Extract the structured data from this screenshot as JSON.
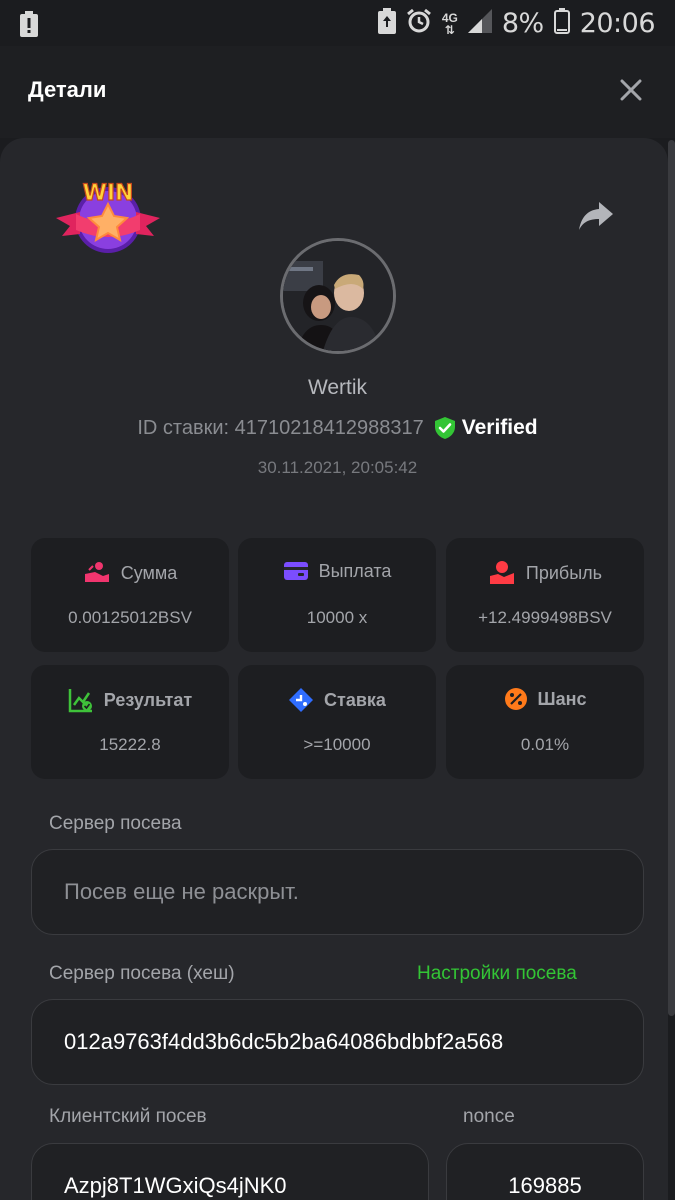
{
  "status_bar": {
    "battery": "8%",
    "time": "20:06",
    "network": "4G"
  },
  "header": {
    "title": "Детали"
  },
  "bet": {
    "username": "Wertik",
    "id_label": "ID ставки: 41710218412988317",
    "verified": "Verified",
    "timestamp": "30.11.2021, 20:05:42",
    "badge_text": "WIN"
  },
  "stats": [
    {
      "label": "Сумма",
      "value": "0.00125012BSV",
      "icon": "coins-hand-icon"
    },
    {
      "label": "Выплата",
      "value": "10000 x",
      "icon": "wallet-icon"
    },
    {
      "label": "Прибыль",
      "value": "+12.4999498BSV",
      "icon": "profit-hand-icon"
    },
    {
      "label": "Результат",
      "value": "15222.8",
      "icon": "chart-check-icon"
    },
    {
      "label": "Ставка",
      "value": ">=10000",
      "icon": "target-tag-icon"
    },
    {
      "label": "Шанс",
      "value": "0.01%",
      "icon": "percent-icon"
    }
  ],
  "seed": {
    "server_label": "Сервер посева",
    "server_value": "Посев еще не раскрыт.",
    "hash_label": "Сервер посева (хеш)",
    "settings_link": "Настройки посева",
    "hash_value": "012a9763f4dd3b6dc5b2ba64086bdbbf2a568",
    "client_label": "Клиентский посев",
    "client_value": "Azpj8T1WGxiQs4jNK0",
    "nonce_label": "nonce",
    "nonce_value": "169885"
  },
  "colors": {
    "background": "#1b1c1f",
    "card": "#26272b",
    "tile": "#1d1e21",
    "accent_green": "#33c535",
    "icon_pink": "#f0356e",
    "icon_purple": "#7b4dff",
    "icon_red": "#ff3b44",
    "icon_green": "#3fc23a",
    "icon_blue": "#2f6dff",
    "icon_orange": "#ff7a1a"
  }
}
